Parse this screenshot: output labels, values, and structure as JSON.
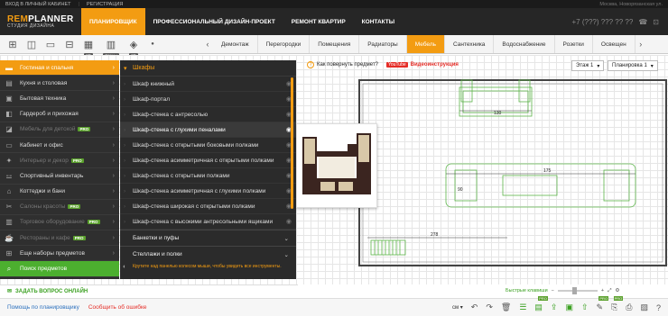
{
  "topbar": {
    "login": "ВХОД В ЛИЧНЫЙ КАБИНЕТ",
    "register": "РЕГИСТРАЦИЯ",
    "right": "Москва, Новорязанская ул."
  },
  "logo": {
    "part1": "REM",
    "part2": "PLANNER",
    "subtitle": "СТУДИЯ ДИЗАЙНА"
  },
  "nav": [
    "ПЛАНИРОВЩИК",
    "ПРОФЕССИОНАЛЬНЫЙ ДИЗАЙН-ПРОЕКТ",
    "РЕМОНТ КВАРТИР",
    "КОНТАКТЫ"
  ],
  "phone": "+7 (???) ??? ?? ??",
  "tools": {
    "tag_2d": "2D",
    "tag_walls": "Стены",
    "tag_3d": "3D"
  },
  "categories": [
    "Демонтаж",
    "Перегородки",
    "Помещения",
    "Радиаторы",
    "Мебель",
    "Сантехника",
    "Водоснабжение",
    "Розетки",
    "Освещен"
  ],
  "sidebar": {
    "items": [
      {
        "label": "Гостиная и спальня"
      },
      {
        "label": "Кухня и столовая"
      },
      {
        "label": "Бытовая техника"
      },
      {
        "label": "Гардероб и прихожая"
      },
      {
        "label": "Мебель для детской",
        "pro": "PRO"
      },
      {
        "label": "Кабинет и офис"
      },
      {
        "label": "Интерьер и декор",
        "pro": "PRO"
      },
      {
        "label": "Спортивный инвентарь"
      },
      {
        "label": "Коттеджи и бани"
      },
      {
        "label": "Салоны красоты",
        "pro": "PRO"
      },
      {
        "label": "Торговое оборудование",
        "pro": "PRO"
      },
      {
        "label": "Рестораны и кафе",
        "pro": "PRO"
      },
      {
        "label": "Еще наборы предметов"
      },
      {
        "label": "Поиск предметов"
      }
    ]
  },
  "submenu": {
    "title": "Шкафы",
    "items": [
      "Шкаф книжный",
      "Шкаф-портал",
      "Шкаф-стенка с антресолью",
      "Шкаф-стенка с глухими пеналами",
      "Шкаф-стенка с открытыми боковыми полками",
      "Шкаф-стенка асимметричная с открытыми полками",
      "Шкаф-стенка с открытыми полками",
      "Шкаф-стенка асимметричная с глухими полками",
      "Шкаф-стенка широкая с открытыми полками",
      "Шкаф-стенка с высокими антресольными ящиками"
    ],
    "sections": [
      "Банкетки и пуфы",
      "Стеллажи и полки"
    ],
    "hint": "Крутите над панелью колесом мыши, чтобы увидеть все инструменты."
  },
  "help": {
    "question": "Как повернуть предмет?",
    "youtube": "YouTube",
    "video": "Видеоинструкция"
  },
  "floor": {
    "level": "Этаж 1",
    "plan": "Планировка 1"
  },
  "plan": {
    "dim1": "130",
    "dim2": "175",
    "dim3": "278",
    "dim4": "90"
  },
  "ask": "ЗАДАТЬ ВОПРОС ОНЛАЙН",
  "zoom": {
    "label": "Быстрые клавиши"
  },
  "bottom": {
    "help": "Помощь по планировщику",
    "error": "Сообщить об ошибке",
    "unit": "см"
  },
  "colors": {
    "accent": "#f39c12",
    "green": "#4caf2f",
    "pro": "#5aa02c"
  }
}
